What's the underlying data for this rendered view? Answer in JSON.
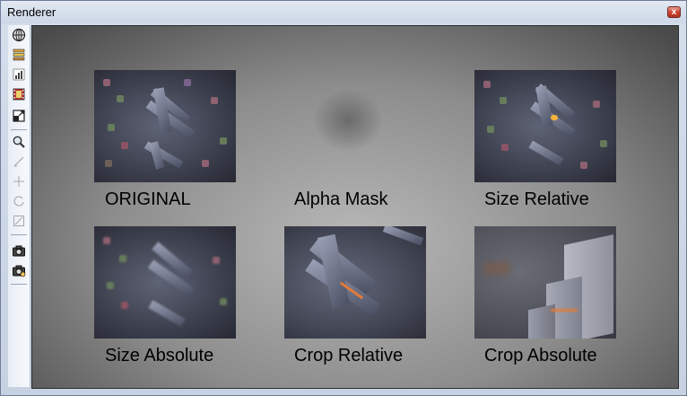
{
  "window": {
    "title": "Renderer",
    "close_symbol": "x"
  },
  "toolbar": {
    "buttons": [
      {
        "name": "globe-icon"
      },
      {
        "name": "layers-icon"
      },
      {
        "name": "histogram-icon"
      },
      {
        "name": "film-icon"
      },
      {
        "name": "fit-window-icon"
      },
      {
        "name": "zoom-icon"
      },
      {
        "name": "pencil-icon"
      },
      {
        "name": "move-icon"
      },
      {
        "name": "rotate-icon"
      },
      {
        "name": "scale-icon"
      },
      {
        "name": "camera-icon"
      },
      {
        "name": "camera-settings-icon"
      }
    ]
  },
  "tiles": [
    {
      "label": "ORIGINAL"
    },
    {
      "label": "Alpha Mask"
    },
    {
      "label": "Size Relative"
    },
    {
      "label": "Size Absolute"
    },
    {
      "label": "Crop Relative"
    },
    {
      "label": "Crop Absolute"
    }
  ]
}
